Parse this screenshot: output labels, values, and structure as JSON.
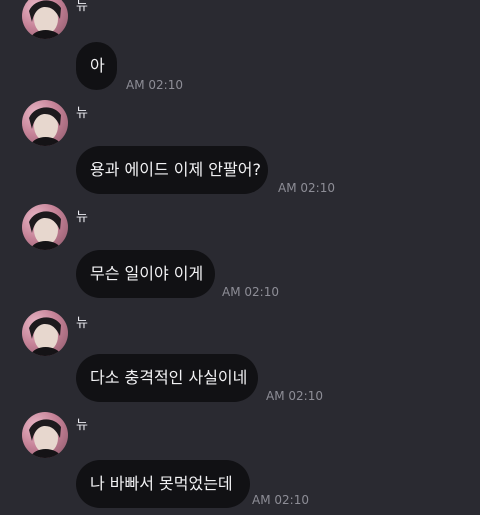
{
  "messages": [
    {
      "sender": "뉴",
      "text": "아",
      "time": "AM 02:10"
    },
    {
      "sender": "뉴",
      "text": "용과 에이드 이제 안팔어?",
      "time": "AM 02:10"
    },
    {
      "sender": "뉴",
      "text": "무슨 일이야 이게",
      "time": "AM 02:10"
    },
    {
      "sender": "뉴",
      "text": "다소 충격적인 사실이네",
      "time": "AM 02:10"
    },
    {
      "sender": "뉴",
      "text": "나 바빠서 못먹었는데",
      "time": "AM 02:10"
    }
  ],
  "colors": {
    "background": "#2a2a31",
    "bubble": "#111114",
    "text": "#f2f2f4",
    "time": "#8d8d96"
  },
  "icons": {
    "avatar": "profile-photo"
  }
}
